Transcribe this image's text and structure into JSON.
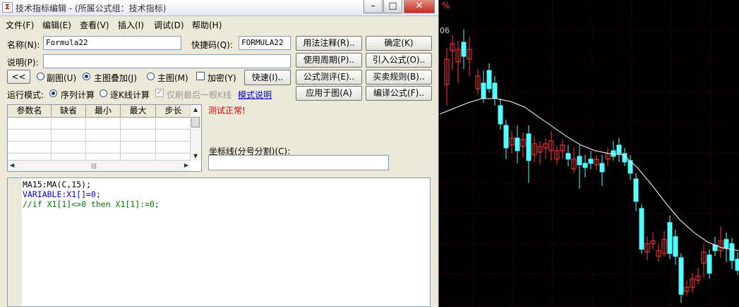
{
  "window": {
    "title": "技术指标编辑 - (所属公式组：技术指标)",
    "icon": "formula-app-icon",
    "controls": [
      "minimize",
      "maximize",
      "close"
    ]
  },
  "menu": [
    "文件(F)",
    "编辑(E)",
    "查看(V)",
    "插入(I)",
    "调试(D)",
    "帮助(H)"
  ],
  "form": {
    "name_label": "名称(N):",
    "name_value": "Formula22",
    "shortcut_label": "快捷码(Q):",
    "shortcut_value": "FORMULA22",
    "desc_label": "说明(P):",
    "desc_value": "",
    "collapse_label": "<<",
    "radio_sub": "副图(U)",
    "radio_overlay": "主图叠加(J)",
    "radio_main": "主图(M)",
    "check_encrypt": "加密(Y)",
    "quick_label": "快速(I)..",
    "run_mode_label": "运行模式:",
    "run_seq": "序列计算",
    "run_step": "逐K线计算",
    "last_bar": "仅刷最后一根K线",
    "mode_help": "模式说明",
    "status": "测试正常!",
    "axis_label": "坐标线(分号分割)(C):",
    "axis_value": ""
  },
  "buttons": {
    "usage_notes": "用法注释(R)..",
    "confirm": "确定(K)",
    "period": "使用周期(P)..",
    "import": "引入公式(O)..",
    "test": "公式测评(E)..",
    "trade_rules": "买卖规则(B)..",
    "apply": "应用于图(A)",
    "compile": "编译公式(F).."
  },
  "params_table": {
    "headers": [
      "参数名",
      "缺省",
      "最小",
      "最大",
      "步长"
    ],
    "rows": []
  },
  "code_lines": [
    "MA15:MA(C,15);",
    "VARIABLE:X1[]=0;",
    "//if X1[1]<>0 then X1[1]:=0;"
  ],
  "chart": {
    "corner_label": "%",
    "price_label": "06",
    "colors": {
      "up": "#ff3c3c",
      "down": "#54ffff",
      "ma": "#ffffff",
      "grid": "#7a0000"
    }
  }
}
